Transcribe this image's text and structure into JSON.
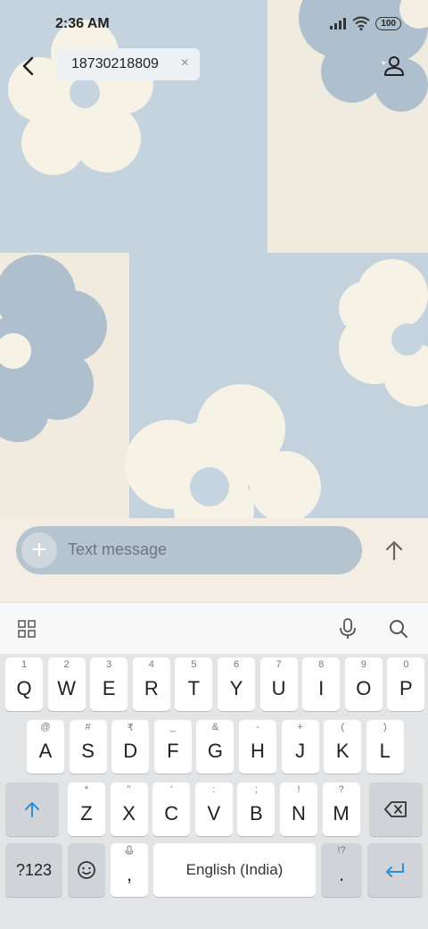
{
  "status_bar": {
    "time": "2:36 AM",
    "battery": "100"
  },
  "header": {
    "recipient": "18730218809",
    "chip_close": "×",
    "back_icon": "chevron-left-icon",
    "contact_icon": "person-icon"
  },
  "compose": {
    "placeholder": "Text message",
    "attach_symbol": "+",
    "send_icon": "arrow-up-icon"
  },
  "keyboard_toolbar": {
    "icons": [
      "grid-icon",
      "microphone-icon",
      "search-icon"
    ]
  },
  "keyboard": {
    "row1": [
      {
        "label": "Q",
        "hint": "1"
      },
      {
        "label": "W",
        "hint": "2"
      },
      {
        "label": "E",
        "hint": "3"
      },
      {
        "label": "R",
        "hint": "4"
      },
      {
        "label": "T",
        "hint": "5"
      },
      {
        "label": "Y",
        "hint": "6"
      },
      {
        "label": "U",
        "hint": "7"
      },
      {
        "label": "I",
        "hint": "8"
      },
      {
        "label": "O",
        "hint": "9"
      },
      {
        "label": "P",
        "hint": "0"
      }
    ],
    "row2": [
      {
        "label": "A",
        "hint": "@"
      },
      {
        "label": "S",
        "hint": "#"
      },
      {
        "label": "D",
        "hint": "₹"
      },
      {
        "label": "F",
        "hint": "_"
      },
      {
        "label": "G",
        "hint": "&"
      },
      {
        "label": "H",
        "hint": "-"
      },
      {
        "label": "J",
        "hint": "+"
      },
      {
        "label": "K",
        "hint": "("
      },
      {
        "label": "L",
        "hint": ")"
      }
    ],
    "row3": [
      {
        "label": "Z",
        "hint": "*"
      },
      {
        "label": "X",
        "hint": "\""
      },
      {
        "label": "C",
        "hint": "'"
      },
      {
        "label": "V",
        "hint": ":"
      },
      {
        "label": "B",
        "hint": ";"
      },
      {
        "label": "N",
        "hint": "!"
      },
      {
        "label": "M",
        "hint": "?"
      }
    ],
    "symbols_key": "?123",
    "comma_key": ",",
    "space_key": "English (India)",
    "period_key": ".",
    "period_hint": "!?",
    "accent_color": "#2a8fd4"
  }
}
